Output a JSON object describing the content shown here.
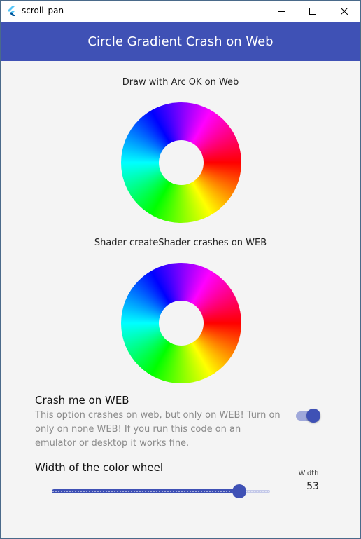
{
  "window": {
    "title": "scroll_pan",
    "icon": "flutter-logo-icon",
    "controls": [
      "minimize-icon",
      "maximize-icon",
      "close-icon"
    ]
  },
  "appbar": {
    "title": "Circle Gradient Crash on Web",
    "color": "#3f51b5"
  },
  "sections": {
    "arc_caption": "Draw with Arc OK on Web",
    "shader_caption": "Shader createShader crashes on WEB"
  },
  "crash_option": {
    "title": "Crash me on WEB",
    "description": "This option crashes on web, but only on WEB! Turn on only on none WEB! If you run this code on an emulator or desktop it works fine.",
    "enabled": true
  },
  "width_control": {
    "title": "Width of the color wheel",
    "label": "Width",
    "value": "53",
    "fraction": 0.86
  },
  "colors": {
    "accent": "#3f51b5",
    "accent_light": "#9fa8da",
    "background": "#f4f4f4"
  }
}
